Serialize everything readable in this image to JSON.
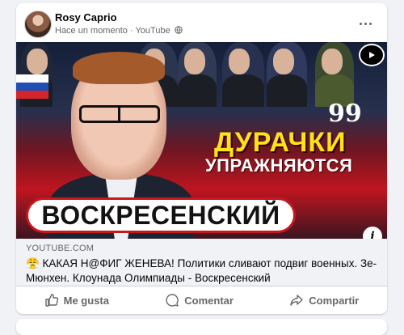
{
  "post": {
    "author": "Rosy Caprio",
    "time": "Hace un momento",
    "separator": "·",
    "source": "YouTube"
  },
  "thumbnail": {
    "headline_line1": "ДУРАЧКИ",
    "headline_line2": "УПРАЖНЯЮТСЯ",
    "quote_mark": "99",
    "name_badge": "ВОСКРЕСЕНСКИЙ",
    "info_label": "i"
  },
  "link": {
    "domain": "YOUTUBE.COM",
    "title": "😤 КАКАЯ Н@ФИГ ЖЕНЕВА! Политики сливают подвиг военных. Зе-Мюнхен. Клоунада Олимпиады - Воскресенский"
  },
  "actions": {
    "like": "Me gusta",
    "comment": "Comentar",
    "share": "Compartir"
  },
  "colors": {
    "accent_red": "#c8161e",
    "headline_yellow": "#ffe11a",
    "meta_gray": "#65676b"
  }
}
